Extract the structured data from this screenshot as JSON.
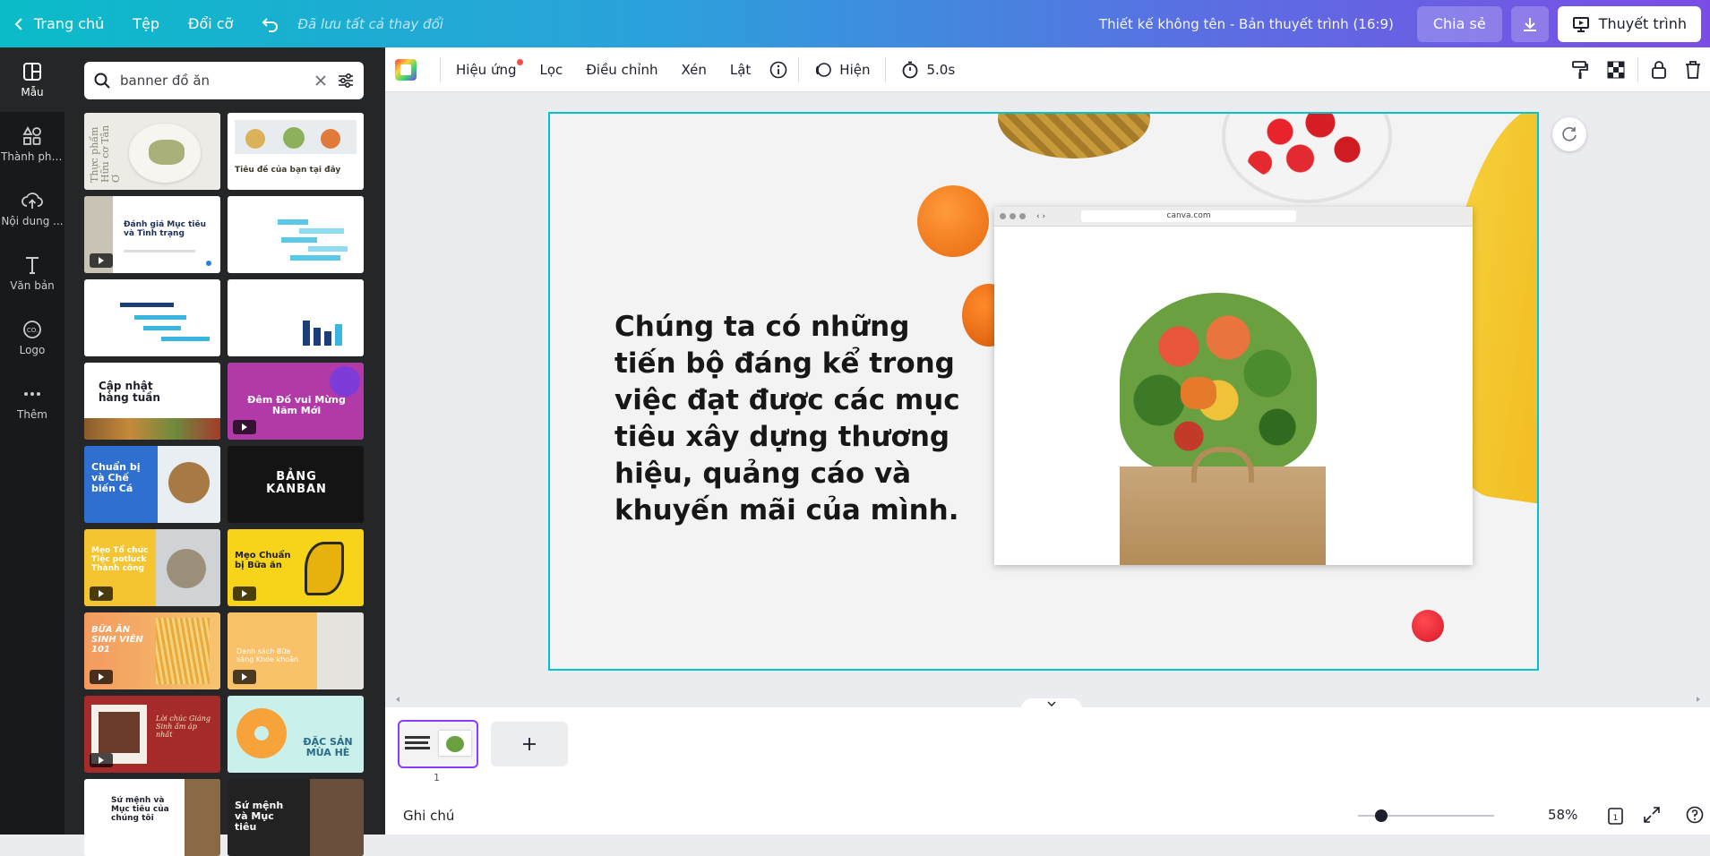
{
  "topbar": {
    "home": "Trang chủ",
    "file": "Tệp",
    "resize": "Đổi cỡ",
    "saved": "Đã lưu tất cả thay đổi",
    "doc_title": "Thiết kế không tên - Bản thuyết trình (16:9)",
    "share": "Chia sẻ",
    "present": "Thuyết trình"
  },
  "rail": {
    "items": [
      {
        "label": "Mẫu",
        "icon": "templates-icon"
      },
      {
        "label": "Thành phần",
        "icon": "elements-icon"
      },
      {
        "label": "Nội dung ...",
        "icon": "upload-icon"
      },
      {
        "label": "Văn bản",
        "icon": "text-icon"
      },
      {
        "label": "Logo",
        "icon": "logo-icon"
      },
      {
        "label": "Thêm",
        "icon": "more-icon"
      }
    ]
  },
  "search": {
    "value": "banner đồ ăn"
  },
  "templates": {
    "t1_text": "Thực phẩm Hữu cơ Tân Ơ",
    "t2_text": "Tiêu đề của bạn tại đây",
    "t3_text": "Đánh giá Mục tiêu và Tình trạng",
    "t7_text": "Cập nhật hàng tuần",
    "t8_text": "Đêm Đố vui Mừng Năm Mới",
    "t9_text": "Chuẩn bị và Chế biến Cá",
    "t10_text": "BẢNG KANBAN",
    "t11_text": "Mẹo Tổ chức Tiệc potluck Thành công",
    "t12_text": "Mẹo Chuẩn bị Bữa ăn",
    "t13_text": "BỮA ĂN SINH VIÊN 101",
    "t14_text": "Danh sách Bữa sáng Khỏe khoắn",
    "t15_text": "Lời chúc Giáng Sinh ấm áp nhất",
    "t16_text": "ĐẶC SẢN MÙA HÈ",
    "t17_text": "Sứ mệnh và Mục tiêu của chúng tôi",
    "t18_text": "Sứ mệnh và Mục tiêu"
  },
  "toolbar": {
    "effects": "Hiệu ứng",
    "filter": "Lọc",
    "adjust": "Điều chỉnh",
    "crop": "Xén",
    "flip": "Lật",
    "show": "Hiện",
    "duration": "5.0s"
  },
  "slide": {
    "text": "Chúng ta có những tiến bộ đáng kể trong việc đạt được các mục tiêu xây dựng thương hiệu, quảng cáo và khuyến mãi của mình.",
    "url": "canva.com"
  },
  "pages": {
    "num": "1"
  },
  "bottombar": {
    "notes": "Ghi chú",
    "zoom": "58%",
    "page_count": "1"
  },
  "colors": {
    "accent": "#8b3dff",
    "selection": "#00c4cc"
  }
}
